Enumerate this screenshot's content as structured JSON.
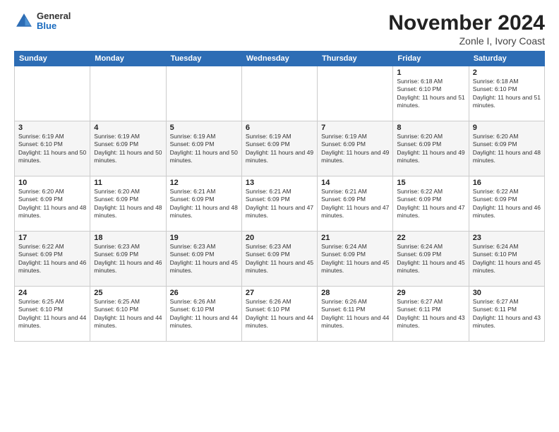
{
  "logo": {
    "general": "General",
    "blue": "Blue"
  },
  "header": {
    "title": "November 2024",
    "location": "Zonle I, Ivory Coast"
  },
  "weekdays": [
    "Sunday",
    "Monday",
    "Tuesday",
    "Wednesday",
    "Thursday",
    "Friday",
    "Saturday"
  ],
  "weeks": [
    [
      {
        "day": "",
        "info": ""
      },
      {
        "day": "",
        "info": ""
      },
      {
        "day": "",
        "info": ""
      },
      {
        "day": "",
        "info": ""
      },
      {
        "day": "",
        "info": ""
      },
      {
        "day": "1",
        "info": "Sunrise: 6:18 AM\nSunset: 6:10 PM\nDaylight: 11 hours and 51 minutes."
      },
      {
        "day": "2",
        "info": "Sunrise: 6:18 AM\nSunset: 6:10 PM\nDaylight: 11 hours and 51 minutes."
      }
    ],
    [
      {
        "day": "3",
        "info": "Sunrise: 6:19 AM\nSunset: 6:10 PM\nDaylight: 11 hours and 50 minutes."
      },
      {
        "day": "4",
        "info": "Sunrise: 6:19 AM\nSunset: 6:09 PM\nDaylight: 11 hours and 50 minutes."
      },
      {
        "day": "5",
        "info": "Sunrise: 6:19 AM\nSunset: 6:09 PM\nDaylight: 11 hours and 50 minutes."
      },
      {
        "day": "6",
        "info": "Sunrise: 6:19 AM\nSunset: 6:09 PM\nDaylight: 11 hours and 49 minutes."
      },
      {
        "day": "7",
        "info": "Sunrise: 6:19 AM\nSunset: 6:09 PM\nDaylight: 11 hours and 49 minutes."
      },
      {
        "day": "8",
        "info": "Sunrise: 6:20 AM\nSunset: 6:09 PM\nDaylight: 11 hours and 49 minutes."
      },
      {
        "day": "9",
        "info": "Sunrise: 6:20 AM\nSunset: 6:09 PM\nDaylight: 11 hours and 48 minutes."
      }
    ],
    [
      {
        "day": "10",
        "info": "Sunrise: 6:20 AM\nSunset: 6:09 PM\nDaylight: 11 hours and 48 minutes."
      },
      {
        "day": "11",
        "info": "Sunrise: 6:20 AM\nSunset: 6:09 PM\nDaylight: 11 hours and 48 minutes."
      },
      {
        "day": "12",
        "info": "Sunrise: 6:21 AM\nSunset: 6:09 PM\nDaylight: 11 hours and 48 minutes."
      },
      {
        "day": "13",
        "info": "Sunrise: 6:21 AM\nSunset: 6:09 PM\nDaylight: 11 hours and 47 minutes."
      },
      {
        "day": "14",
        "info": "Sunrise: 6:21 AM\nSunset: 6:09 PM\nDaylight: 11 hours and 47 minutes."
      },
      {
        "day": "15",
        "info": "Sunrise: 6:22 AM\nSunset: 6:09 PM\nDaylight: 11 hours and 47 minutes."
      },
      {
        "day": "16",
        "info": "Sunrise: 6:22 AM\nSunset: 6:09 PM\nDaylight: 11 hours and 46 minutes."
      }
    ],
    [
      {
        "day": "17",
        "info": "Sunrise: 6:22 AM\nSunset: 6:09 PM\nDaylight: 11 hours and 46 minutes."
      },
      {
        "day": "18",
        "info": "Sunrise: 6:23 AM\nSunset: 6:09 PM\nDaylight: 11 hours and 46 minutes."
      },
      {
        "day": "19",
        "info": "Sunrise: 6:23 AM\nSunset: 6:09 PM\nDaylight: 11 hours and 45 minutes."
      },
      {
        "day": "20",
        "info": "Sunrise: 6:23 AM\nSunset: 6:09 PM\nDaylight: 11 hours and 45 minutes."
      },
      {
        "day": "21",
        "info": "Sunrise: 6:24 AM\nSunset: 6:09 PM\nDaylight: 11 hours and 45 minutes."
      },
      {
        "day": "22",
        "info": "Sunrise: 6:24 AM\nSunset: 6:09 PM\nDaylight: 11 hours and 45 minutes."
      },
      {
        "day": "23",
        "info": "Sunrise: 6:24 AM\nSunset: 6:10 PM\nDaylight: 11 hours and 45 minutes."
      }
    ],
    [
      {
        "day": "24",
        "info": "Sunrise: 6:25 AM\nSunset: 6:10 PM\nDaylight: 11 hours and 44 minutes."
      },
      {
        "day": "25",
        "info": "Sunrise: 6:25 AM\nSunset: 6:10 PM\nDaylight: 11 hours and 44 minutes."
      },
      {
        "day": "26",
        "info": "Sunrise: 6:26 AM\nSunset: 6:10 PM\nDaylight: 11 hours and 44 minutes."
      },
      {
        "day": "27",
        "info": "Sunrise: 6:26 AM\nSunset: 6:10 PM\nDaylight: 11 hours and 44 minutes."
      },
      {
        "day": "28",
        "info": "Sunrise: 6:26 AM\nSunset: 6:11 PM\nDaylight: 11 hours and 44 minutes."
      },
      {
        "day": "29",
        "info": "Sunrise: 6:27 AM\nSunset: 6:11 PM\nDaylight: 11 hours and 43 minutes."
      },
      {
        "day": "30",
        "info": "Sunrise: 6:27 AM\nSunset: 6:11 PM\nDaylight: 11 hours and 43 minutes."
      }
    ]
  ]
}
